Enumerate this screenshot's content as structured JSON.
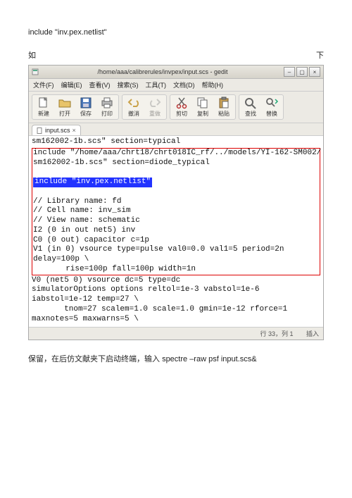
{
  "intro_line": "include \"inv.pex.netlist\"",
  "left_char": "如",
  "right_char": "下",
  "window_title": "/home/aaa/calibrerules/invpex/input.scs - gedit",
  "winbtns": {
    "min": "–",
    "max": "▢",
    "close": "×"
  },
  "menu": {
    "file": "文件(F)",
    "edit": "编辑(E)",
    "view": "查看(V)",
    "search": "搜索(S)",
    "tools": "工具(T)",
    "docs": "文档(D)",
    "help": "帮助(H)"
  },
  "toolbar": {
    "new": "新建",
    "open": "打开",
    "save": "保存",
    "print": "打印",
    "undo": "撤消",
    "redo": "重做",
    "cut": "剪切",
    "copy": "复制",
    "paste": "粘贴",
    "find": "查找",
    "replace": "替换"
  },
  "tab_label": "input.scs",
  "code": {
    "pre1": "sm162002-1b.scs\" section=typical",
    "box_l1": "include \"/home/aaa/chrt18/chrt018IC_rf/../models/YI-162-SM002/",
    "box_l2": "sm162002-1b.scs\" section=diode_typical",
    "box_hl": "include \"inv.pex.netlist\"",
    "box_c1": "// Library name: fd",
    "box_c2": "// Cell name: inv_sim",
    "box_c3": "// View name: schematic",
    "box_c4": "I2 (0 in out net5) inv",
    "box_c5": "C0 (0 out) capacitor c=1p",
    "box_c6": "V1 (in 0) vsource type=pulse val0=0.0 val1=5 period=2n",
    "box_c7": "delay=100p \\",
    "box_c8": "       rise=100p fall=100p width=1n",
    "after1": "V0 (net5 0) vsource dc=5 type=dc",
    "after2": "simulatorOptions options reltol=1e-3 vabstol=1e-6",
    "after3": "iabstol=1e-12 temp=27 \\",
    "after4": "       tnom=27 scalem=1.0 scale=1.0 gmin=1e-12 rforce=1",
    "after5": "maxnotes=5 maxwarns=5 \\"
  },
  "status": {
    "line": "行 33，列 1",
    "mode": "插入"
  },
  "closing_zh": "保留，在后仿文献夹下启动终端，输入 ",
  "closing_cmd": "spectre –raw psf input.scs&"
}
